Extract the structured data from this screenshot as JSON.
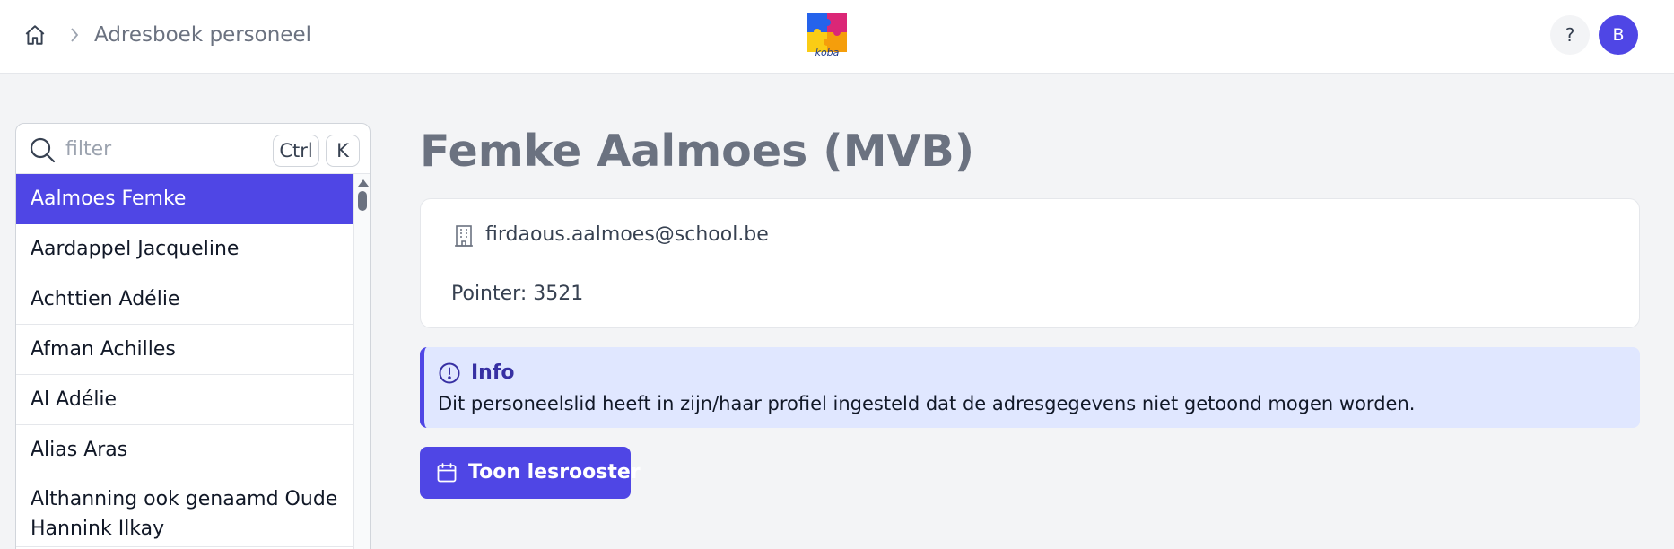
{
  "header": {
    "breadcrumb": "Adresboek personeel",
    "help_label": "?",
    "avatar_initial": "B",
    "icons": {
      "home": "home-icon",
      "separator": "chevron-right-icon",
      "logo": "koba-logo"
    },
    "logo_text": "koba"
  },
  "sidebar": {
    "search": {
      "placeholder": "filter",
      "value": ""
    },
    "shortcut_keys": [
      "Ctrl",
      "K"
    ],
    "items": [
      {
        "label": "Aalmoes Femke",
        "selected": true
      },
      {
        "label": "Aardappel Jacqueline"
      },
      {
        "label": "Achttien Adélie"
      },
      {
        "label": "Afman Achilles"
      },
      {
        "label": "Al Adélie"
      },
      {
        "label": "Alias Aras"
      },
      {
        "label": "Althanning ook genaamd Oude Hannink Ilkay"
      }
    ]
  },
  "detail": {
    "title": "Femke Aalmoes (MVB)",
    "email": "firdaous.aalmoes@school.be",
    "pointer": "Pointer: 3521",
    "info": {
      "title": "Info",
      "text": "Dit personeelslid heeft in zijn/haar profiel ingesteld dat de adresgegevens niet getoond mogen worden."
    },
    "schedule_button": "Toon lesrooster"
  },
  "colors": {
    "accent": "#4f46e5",
    "info_bg": "#e0e7ff",
    "info_title": "#3730a3",
    "page_bg": "#f3f4f6",
    "title_gray": "#6b7280"
  }
}
